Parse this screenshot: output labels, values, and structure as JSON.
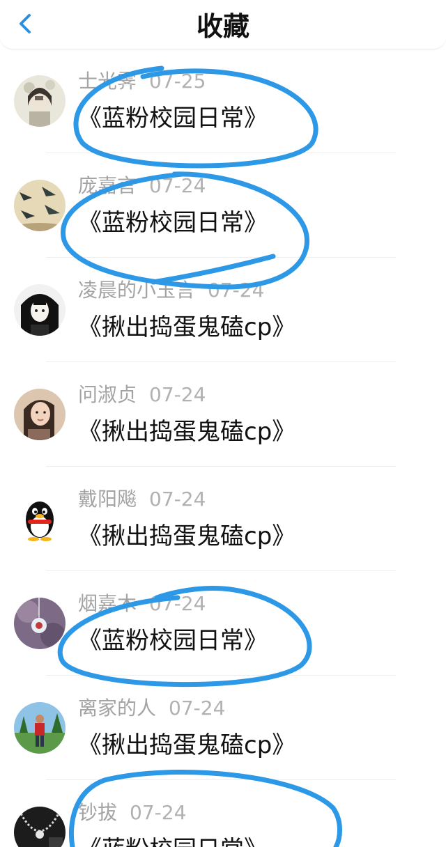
{
  "header": {
    "title": "收藏",
    "back_icon": "chevron-left-icon"
  },
  "colors": {
    "accent": "#2b8fe0",
    "annotation": "#2c98e6",
    "meta_text": "#a3a3a3",
    "title_text": "#111111",
    "divider": "#eeeeee"
  },
  "items": [
    {
      "author": "士光霁",
      "time": "07-25",
      "title": "《蓝粉校园日常》",
      "avatar": "illustrated-girl-avatar"
    },
    {
      "author": "庞嘉言",
      "time": "07-24",
      "title": "《蓝粉校园日常》",
      "avatar": "swallows-painting-avatar"
    },
    {
      "author": "凌晨的小玉言",
      "time": "07-24",
      "title": "《揪出捣蛋鬼磕cp》",
      "avatar": "anime-girl-avatar"
    },
    {
      "author": "问淑贞",
      "time": "07-24",
      "title": "《揪出捣蛋鬼磕cp》",
      "avatar": "woman-photo-avatar"
    },
    {
      "author": "戴阳飚",
      "time": "07-24",
      "title": "《揪出捣蛋鬼磕cp》",
      "avatar": "qq-penguin-avatar"
    },
    {
      "author": "烟嘉木",
      "time": "07-24",
      "title": "《蓝粉校园日常》",
      "avatar": "crystal-pendant-avatar"
    },
    {
      "author": "离家的人",
      "time": "07-24",
      "title": "《揪出捣蛋鬼磕cp》",
      "avatar": "man-outdoor-avatar"
    },
    {
      "author": "钞拔",
      "time": "07-24",
      "title": "《蓝粉校园日常》",
      "avatar": "necklace-avatar"
    }
  ]
}
